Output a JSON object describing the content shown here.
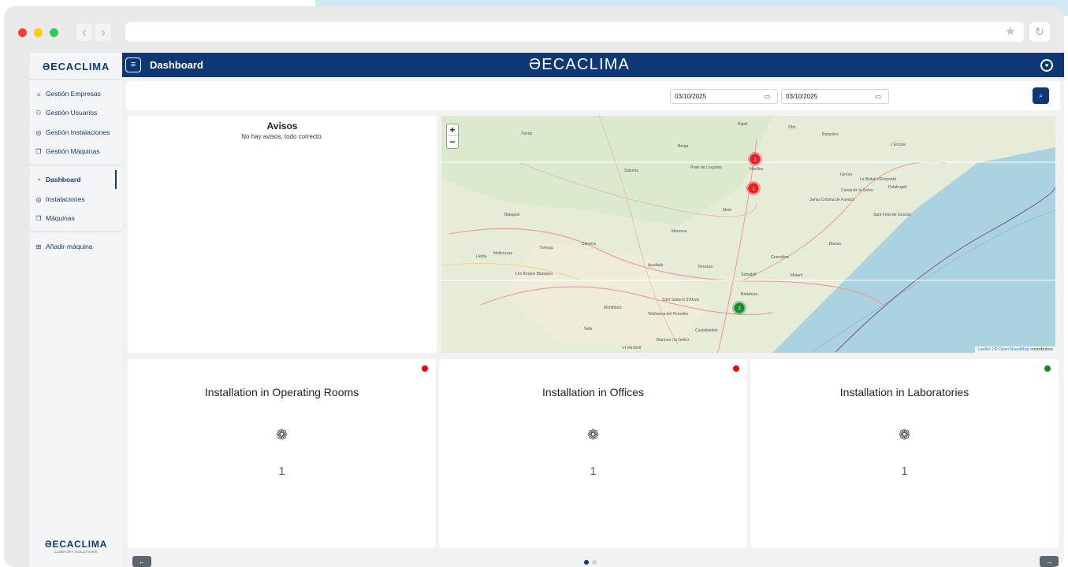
{
  "browser": {
    "star_icon": "star-icon",
    "reload_icon": "reload-icon"
  },
  "app": {
    "brand": "ƏECACLIMA",
    "brand_sub": "COMFORT SOLUTIONS"
  },
  "sidebar": {
    "items": [
      {
        "label": "Gestión Empresas",
        "icon": "building-icon"
      },
      {
        "label": "Gestión Usuarios",
        "icon": "users-icon"
      },
      {
        "label": "Gestión Instalaciones",
        "icon": "location-pin-icon"
      },
      {
        "label": "Gestión Máquinas",
        "icon": "machine-icon"
      },
      {
        "label": "Dashboard",
        "icon": "dashboard-icon"
      },
      {
        "label": "Instalaciones",
        "icon": "location-pin-icon"
      },
      {
        "label": "Máquinas",
        "icon": "machine-icon"
      },
      {
        "label": "Añadir máquina",
        "icon": "plus-square-icon"
      }
    ]
  },
  "header": {
    "title": "Dashboard"
  },
  "filters": {
    "date_from": "03/10/2025",
    "date_to": "03/10/2025"
  },
  "avisos": {
    "title": "Avisos",
    "message": "No hay avisos, todo correcto."
  },
  "map": {
    "zoom_in": "+",
    "zoom_out": "−",
    "attribution_leaflet": "Leaflet",
    "attribution_sep": " | © ",
    "attribution_osm": "OpenStreetMap",
    "attribution_tail": " contributors",
    "places": [
      {
        "name": "Tremp"
      },
      {
        "name": "Ripoll"
      },
      {
        "name": "Olot"
      },
      {
        "name": "Banyoles"
      },
      {
        "name": "Berga"
      },
      {
        "name": "L'Escala"
      },
      {
        "name": "Prats de Lluçanès"
      },
      {
        "name": "Manlleu"
      },
      {
        "name": "Solsona"
      },
      {
        "name": "Girona"
      },
      {
        "name": "La Bisbal d'Empordà"
      },
      {
        "name": "Palafrugell"
      },
      {
        "name": "Cassà de la Selva"
      },
      {
        "name": "Santa Coloma de Farners"
      },
      {
        "name": "Vic"
      },
      {
        "name": "Moià"
      },
      {
        "name": "Sant Feliu de Guíxols"
      },
      {
        "name": "Balaguer"
      },
      {
        "name": "Manresa"
      },
      {
        "name": "Cervera"
      },
      {
        "name": "Blanes"
      },
      {
        "name": "Lleida"
      },
      {
        "name": "Tàrrega"
      },
      {
        "name": "Mollerussa"
      },
      {
        "name": "Igualada"
      },
      {
        "name": "Terrassa"
      },
      {
        "name": "Granollers"
      },
      {
        "name": "Mataró"
      },
      {
        "name": "Les Borges Blanques"
      },
      {
        "name": "Sabadell"
      },
      {
        "name": "Badalona"
      },
      {
        "name": "Montblanc"
      },
      {
        "name": "Sant Sadurní d'Anoia"
      },
      {
        "name": "Vilafranca del Penedès"
      },
      {
        "name": "Valls"
      },
      {
        "name": "Castelldefels"
      },
      {
        "name": "Vilanova i la Geltrú"
      },
      {
        "name": "el Vendrell"
      }
    ],
    "markers": [
      {
        "label": "1",
        "color": "#ee1c24"
      },
      {
        "label": "1",
        "color": "#ee1c24"
      },
      {
        "label": "2",
        "color": "#1a8a2a"
      }
    ]
  },
  "cards": [
    {
      "title": "Installation in Operating Rooms",
      "count": "1",
      "status_color": "#ff0000",
      "icon": "fan-icon"
    },
    {
      "title": "Installation in Offices",
      "count": "1",
      "status_color": "#ff0000",
      "icon": "fan-icon"
    },
    {
      "title": "Installation in Laboratories",
      "count": "1",
      "status_color": "#1a8a1a",
      "icon": "fan-icon"
    }
  ],
  "pager": {
    "prev": "←",
    "next": "→",
    "pages": 2,
    "current": 1
  },
  "colors": {
    "primary": "#0d3775",
    "alert": "#ff0000",
    "ok": "#1a8a1a"
  }
}
